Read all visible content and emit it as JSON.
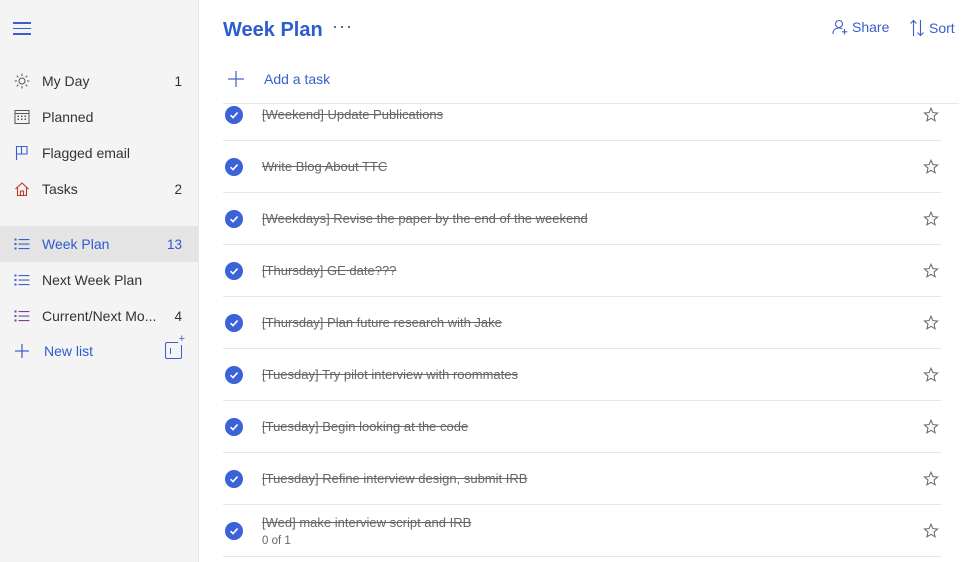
{
  "sidebar": {
    "items": [
      {
        "label": "My Day",
        "count": "1",
        "icon": "sun-icon"
      },
      {
        "label": "Planned",
        "count": "",
        "icon": "calendar-icon"
      },
      {
        "label": "Flagged email",
        "count": "",
        "icon": "flag-icon"
      },
      {
        "label": "Tasks",
        "count": "2",
        "icon": "home-icon"
      }
    ],
    "lists": [
      {
        "label": "Week Plan",
        "count": "13",
        "active": true
      },
      {
        "label": "Next Week Plan",
        "count": ""
      },
      {
        "label": "Current/Next Mo...",
        "count": "4"
      }
    ],
    "new_list_label": "New list"
  },
  "header": {
    "title": "Week Plan",
    "more": "···",
    "share_label": "Share",
    "sort_label": "Sort"
  },
  "add_task_label": "Add a task",
  "tasks": [
    {
      "title": "[Weekend] Update Publications",
      "sub": ""
    },
    {
      "title": "Write Blog About TTC",
      "sub": ""
    },
    {
      "title": "[Weekdays] Revise the paper by the end of the weekend",
      "sub": ""
    },
    {
      "title": "[Thursday] GE date???",
      "sub": ""
    },
    {
      "title": "[Thursday] Plan future research with Jake",
      "sub": ""
    },
    {
      "title": "[Tuesday] Try pilot interview with roommates",
      "sub": ""
    },
    {
      "title": "[Tuesday] Begin looking at the code",
      "sub": ""
    },
    {
      "title": "[Tuesday] Refine interview design, submit IRB",
      "sub": ""
    },
    {
      "title": "[Wed] make interview script and IRB",
      "sub": "0 of 1"
    }
  ],
  "colors": {
    "accent": "#2d5ccf",
    "check": "#3a62d9",
    "sidebar_bg": "#f4f4f4",
    "tasks_icon": "#c0392b",
    "list_icon": "#3a5fcd",
    "list_icon_alt": "#7b3fa0"
  }
}
